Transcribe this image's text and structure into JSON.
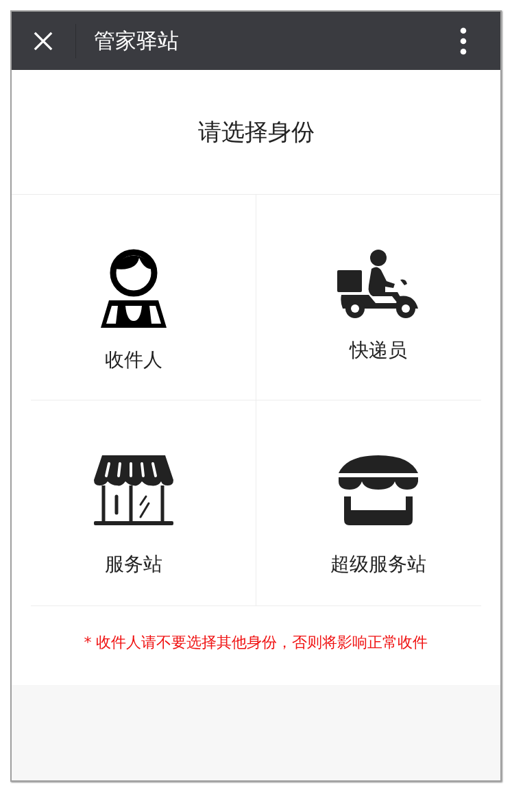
{
  "header": {
    "title": "管家驿站"
  },
  "heading": "请选择身份",
  "options": [
    {
      "label": "收件人",
      "kind": "recipient"
    },
    {
      "label": "快递员",
      "kind": "courier"
    },
    {
      "label": "服务站",
      "kind": "shop"
    },
    {
      "label": "超级服务站",
      "kind": "super_shop"
    }
  ],
  "note": "* 收件人请不要选择其他身份，否则将影响正常收件"
}
